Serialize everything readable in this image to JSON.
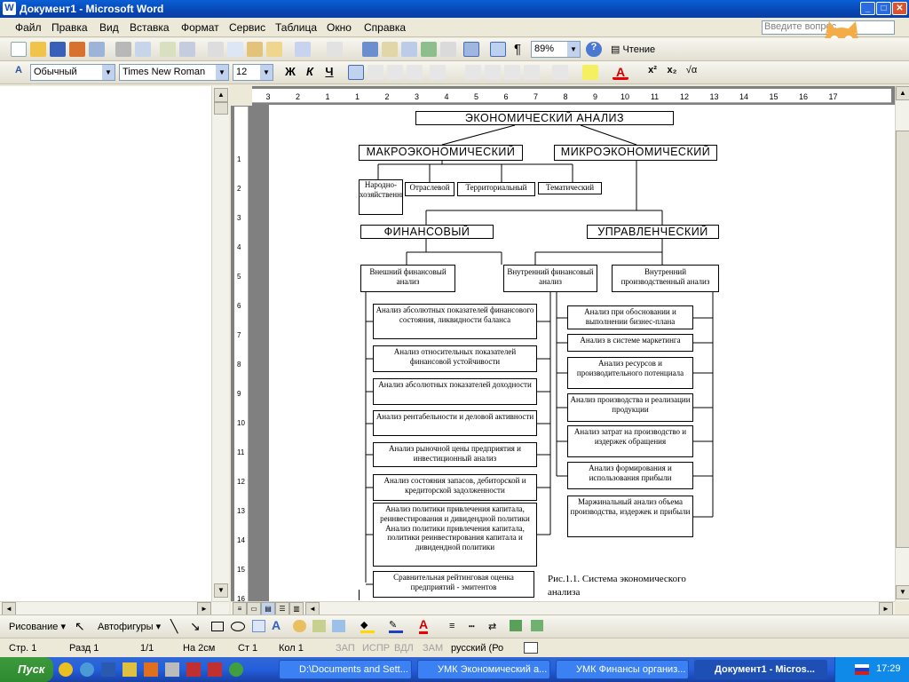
{
  "window": {
    "title": "Документ1 - Microsoft Word"
  },
  "menu": {
    "items": [
      "Файл",
      "Правка",
      "Вид",
      "Вставка",
      "Формат",
      "Сервис",
      "Таблица",
      "Окно",
      "Справка"
    ],
    "ask_placeholder": "Введите вопрос"
  },
  "toolbar": {
    "zoom": "89%",
    "reading": "Чтение"
  },
  "format": {
    "style": "Обычный",
    "font": "Times New Roman",
    "size": "12"
  },
  "ruler": {
    "h_labels": [
      "3",
      "2",
      "1",
      "1",
      "2",
      "3",
      "4",
      "5",
      "6",
      "7",
      "8",
      "9",
      "10",
      "11",
      "12",
      "13",
      "14",
      "15",
      "16",
      "17"
    ],
    "v_labels": [
      "1",
      "2",
      "3",
      "4",
      "5",
      "6",
      "7",
      "8",
      "9",
      "10",
      "11",
      "12",
      "13",
      "14",
      "15",
      "16"
    ]
  },
  "diagram": {
    "root": "ЭКОНОМИЧЕСКИЙ АНАЛИЗ",
    "macro": "МАКРОЭКОНОМИЧЕСКИЙ",
    "micro": "МИКРОЭКОНОМИЧЕСКИЙ",
    "macro_children": [
      "Народно-хозяйственный",
      "Отраслевой",
      "Территориальный",
      "Тематический"
    ],
    "finance": "ФИНАНСОВЫЙ",
    "management": "УПРАВЛЕНЧЕСКИЙ",
    "external": "Внешний финансовый анализ",
    "internal_fin": "Внутренний финансовый анализ",
    "internal_prod": "Внутренний производственный анализ",
    "left_items": [
      "Анализ абсолютных показателей финансового состояния, ликвидности баланса",
      "Анализ относительных показателей финансовой устойчивости",
      "Анализ абсолютных показателей доходности",
      "Анализ рентабельности и деловой активности",
      "Анализ рыночной цены предприятия и инвестиционный анализ",
      "Анализ состояния запасов, дебиторской и кредиторской задолженности",
      "Анализ политики привлечения капитала, реинвестирования и дивидендной политики Анализ политики привлечения капитала, политики реинвестирования капитала и дивидендной политики",
      "Сравнительная рейтинговая оценка предприятий - эмитентов"
    ],
    "right_items": [
      "Анализ при обосновании и выполнении бизнес-плана",
      "Анализ в системе маркетинга",
      "Анализ ресурсов и производительного потенциала",
      "Анализ производства и реализации продукции",
      "Анализ затрат на производство и издержек обращения",
      "Анализ формирования и использования прибыли",
      "Маржинальный анализ объема производства, издержек и прибыли"
    ],
    "caption": "Рис.1.1. Система экономического анализа"
  },
  "drawing": {
    "draw": "Рисование",
    "autoshapes": "Автофигуры"
  },
  "status": {
    "page": "Стр. 1",
    "section": "Разд 1",
    "pages": "1/1",
    "at": "На 2см",
    "line": "Ст 1",
    "col": "Кол 1",
    "rec": "ЗАП",
    "trk": "ИСПР",
    "ext": "ВДЛ",
    "ovr": "ЗАМ",
    "lang": "русский (Ро"
  },
  "taskbar": {
    "start": "Пуск",
    "tasks": [
      "D:\\Documents and Sett...",
      "УМК Экономический а...",
      "УМК Финансы организ...",
      "Документ1 - Micros..."
    ],
    "time": "17:29"
  }
}
